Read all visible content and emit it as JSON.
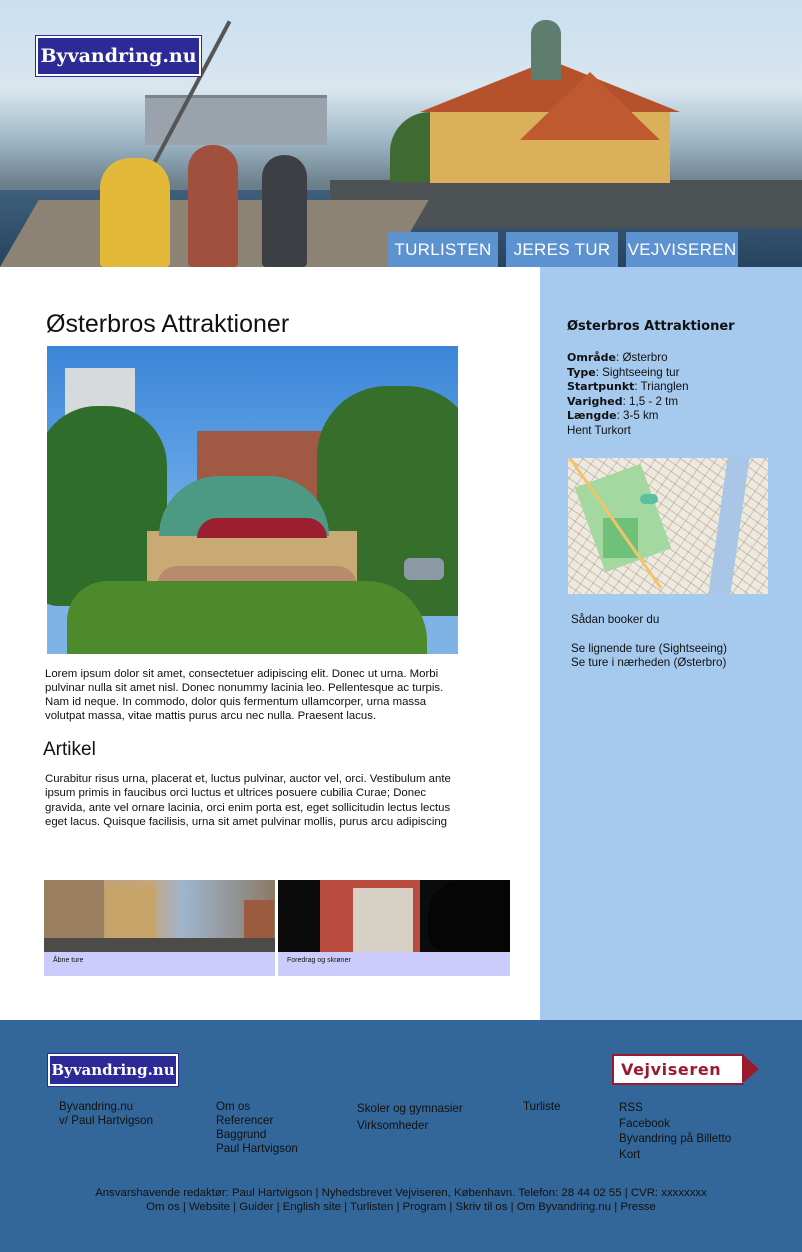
{
  "header": {
    "logo": "Byvandring.nu",
    "nav": [
      {
        "label": "TURLISTEN"
      },
      {
        "label": "JERES TUR"
      },
      {
        "label": "VEJVISEREN"
      }
    ]
  },
  "main": {
    "title": "Østerbros Attraktioner",
    "lede": "Lorem ipsum dolor sit amet, consectetuer adipiscing elit. Donec ut urna. Morbi pulvinar nulla sit amet nisl. Donec nonummy lacinia leo. Pellentesque ac turpis. Nam id neque. In commodo, dolor quis fermentum ullamcorper, urna massa volutpat massa, vitae mattis purus arcu nec nulla. Praesent lacus.",
    "article_title": "Artikel",
    "article_text": "Curabitur risus urna, placerat et, luctus pulvinar, auctor vel, orci. Vestibulum ante ipsum primis in faucibus orci luctus et ultrices posuere cubilia Curae; Donec gravida, ante vel ornare lacinia, orci enim porta est, eget sollicitudin lectus lectus eget lacus. Quisque facilisis, urna sit amet pulvinar mollis, purus arcu adipiscing",
    "cards": [
      {
        "label": "Åbne ture"
      },
      {
        "label": "Foredrag og skrøner"
      }
    ]
  },
  "sidebar": {
    "title": "Østerbros Attraktioner",
    "info": [
      {
        "key": "Område",
        "value": ": Østerbro"
      },
      {
        "key": "Type",
        "value": ": Sightseeing tur"
      },
      {
        "key": "Startpunkt",
        "value": ": Trianglen"
      },
      {
        "key": "Varighed",
        "value": ": 1,5 - 2 tm"
      },
      {
        "key": "Længde",
        "value": ": 3-5 km"
      }
    ],
    "turkort": "Hent Turkort",
    "booking": "Sådan booker du",
    "similar": "Se lignende ture (Sightseeing)",
    "nearby": "Se ture i nærheden (Østerbro)"
  },
  "footer": {
    "logo": "Byvandring.nu",
    "vejviseren": "Vejviseren",
    "col1": [
      "Byvandring.nu",
      "v/ Paul Hartvigson"
    ],
    "col2": [
      "Om os",
      "Referencer",
      "Baggrund",
      "Paul Hartvigson"
    ],
    "col3": [
      "Skoler og gymnasier",
      "Virksomheder"
    ],
    "col4": [
      "Turliste"
    ],
    "col5": [
      "RSS",
      "Facebook",
      "Byvandring på Billetto",
      "Kort"
    ],
    "line1": "Ansvarshavende redaktør: Paul Hartvigson  |  Nyhedsbrevet Vejviseren, København. Telefon: 28 44 02 55   |  CVR: xxxxxxxx",
    "line2": "Om os  |  Website  |  Guider  |  English site  |  Turlisten  |  Program  |  Skriv til os  |  Om Byvandring.nu  |  Presse"
  }
}
